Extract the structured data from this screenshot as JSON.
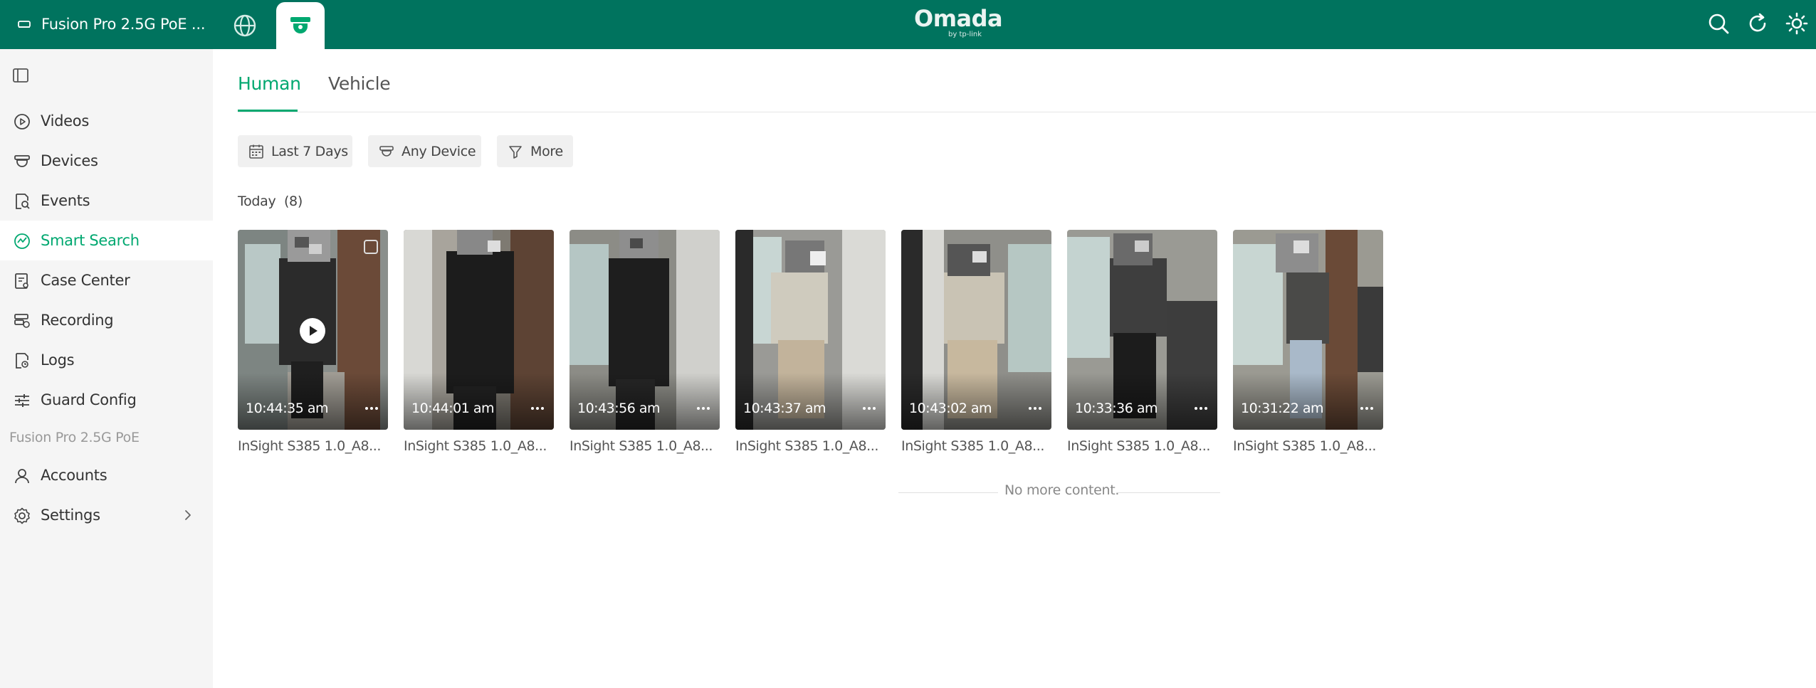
{
  "topbar": {
    "site_name": "Fusion Pro 2.5G PoE ...",
    "logo_text": "Omada",
    "logo_sub": "by tp-link",
    "icons": [
      "router-icon",
      "globe-icon",
      "camera-icon",
      "search-icon",
      "refresh-icon",
      "theme-icon"
    ]
  },
  "sidebar": {
    "items": [
      {
        "label": "Videos",
        "icon": "play-circle-icon"
      },
      {
        "label": "Devices",
        "icon": "camera-icon"
      },
      {
        "label": "Events",
        "icon": "event-search-icon"
      },
      {
        "label": "Smart Search",
        "icon": "smart-search-icon"
      },
      {
        "label": "Case Center",
        "icon": "case-icon"
      },
      {
        "label": "Recording",
        "icon": "recording-icon"
      },
      {
        "label": "Logs",
        "icon": "logs-icon"
      },
      {
        "label": "Guard Config",
        "icon": "sliders-icon"
      }
    ],
    "section_label": "Fusion Pro 2.5G PoE",
    "section_items": [
      {
        "label": "Accounts",
        "icon": "user-icon"
      },
      {
        "label": "Settings",
        "icon": "gear-icon"
      }
    ],
    "active_color": "#00a870"
  },
  "main": {
    "tabs": [
      {
        "label": "Human",
        "active": true
      },
      {
        "label": "Vehicle",
        "active": false
      }
    ],
    "filters": [
      {
        "label": "Last 7 Days",
        "icon": "calendar-icon"
      },
      {
        "label": "Any Device",
        "icon": "camera-icon"
      },
      {
        "label": "More",
        "icon": "filter-icon"
      }
    ],
    "group": {
      "title": "Today",
      "count": "(8)"
    },
    "cards": [
      {
        "time": "10:44:35 am",
        "camera": "InSight S385 1.0_A8..."
      },
      {
        "time": "10:44:01 am",
        "camera": "InSight S385 1.0_A8..."
      },
      {
        "time": "10:43:56 am",
        "camera": "InSight S385 1.0_A8..."
      },
      {
        "time": "10:43:37 am",
        "camera": "InSight S385 1.0_A8..."
      },
      {
        "time": "10:43:02 am",
        "camera": "InSight S385 1.0_A8..."
      },
      {
        "time": "10:33:36 am",
        "camera": "InSight S385 1.0_A8..."
      },
      {
        "time": "10:31:22 am",
        "camera": "InSight S385 1.0_A8..."
      }
    ],
    "no_more": "No more content."
  },
  "colors": {
    "topbar": "#00735e",
    "accent": "#00a870"
  }
}
